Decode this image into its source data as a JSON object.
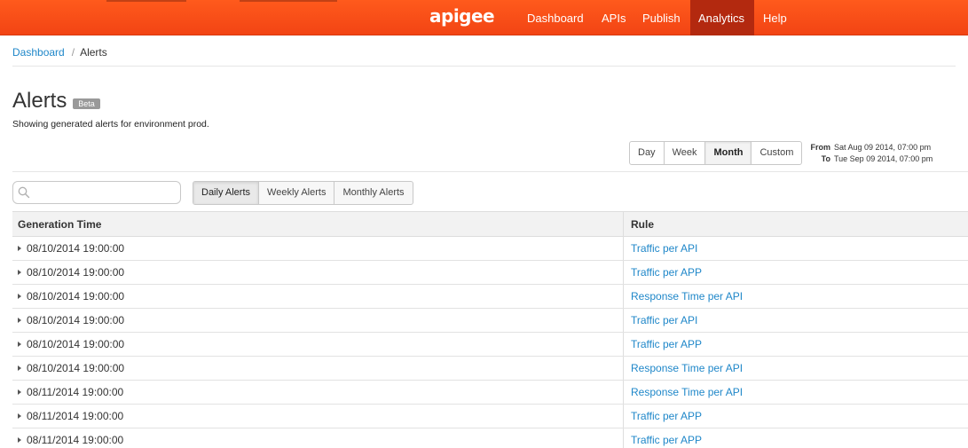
{
  "header": {
    "logo": "apigee",
    "nav": [
      {
        "label": "Dashboard",
        "active": false
      },
      {
        "label": "APIs",
        "active": false
      },
      {
        "label": "Publish",
        "active": false
      },
      {
        "label": "Analytics",
        "active": true
      },
      {
        "label": "Help",
        "active": false
      }
    ],
    "colors": {
      "bar": "#f24414",
      "active_tab": "#b3290f"
    }
  },
  "breadcrumb": {
    "parent": "Dashboard",
    "separator": "/",
    "current": "Alerts"
  },
  "page": {
    "title": "Alerts",
    "badge": "Beta",
    "subtitle": "Showing generated alerts for environment prod."
  },
  "range": {
    "buttons": [
      "Day",
      "Week",
      "Month",
      "Custom"
    ],
    "active": "Month",
    "from_label": "From",
    "from_value": "Sat Aug 09 2014, 07:00 pm",
    "to_label": "To",
    "to_value": "Tue Sep 09 2014, 07:00 pm"
  },
  "search": {
    "placeholder": "",
    "value": "",
    "icon": "search-icon"
  },
  "period_tabs": {
    "items": [
      "Daily Alerts",
      "Weekly Alerts",
      "Monthly Alerts"
    ],
    "active": "Daily Alerts"
  },
  "table": {
    "columns": [
      "Generation Time",
      "Rule"
    ],
    "rows": [
      {
        "time": "08/10/2014 19:00:00",
        "rule": "Traffic per API"
      },
      {
        "time": "08/10/2014 19:00:00",
        "rule": "Traffic per APP"
      },
      {
        "time": "08/10/2014 19:00:00",
        "rule": "Response Time per API"
      },
      {
        "time": "08/10/2014 19:00:00",
        "rule": "Traffic per API"
      },
      {
        "time": "08/10/2014 19:00:00",
        "rule": "Traffic per APP"
      },
      {
        "time": "08/10/2014 19:00:00",
        "rule": "Response Time per API"
      },
      {
        "time": "08/11/2014 19:00:00",
        "rule": "Response Time per API"
      },
      {
        "time": "08/11/2014 19:00:00",
        "rule": "Traffic per APP"
      },
      {
        "time": "08/11/2014 19:00:00",
        "rule": "Traffic per APP"
      }
    ],
    "link_color": "#1f87c9"
  }
}
